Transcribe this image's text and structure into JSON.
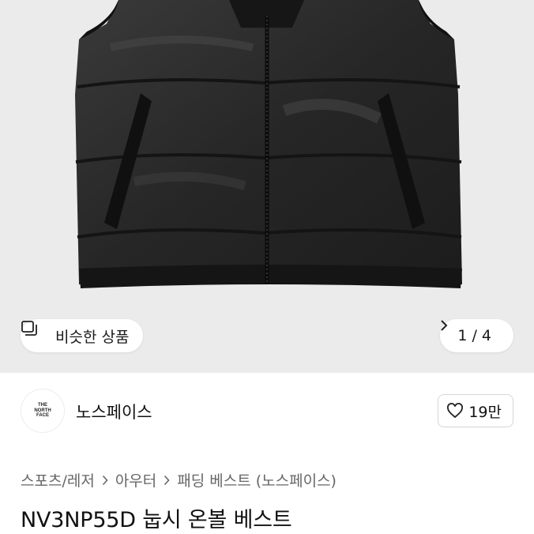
{
  "gallery": {
    "similar_label": "비슷한 상품",
    "pager_label": "1 / 4",
    "current_page": 1,
    "total_pages": 4
  },
  "seller": {
    "logo_line1": "THE",
    "logo_line2": "NORTH",
    "logo_line3": "FACE",
    "name": "노스페이스",
    "likes": "19만"
  },
  "breadcrumb": [
    "스포츠/레저",
    "아우터",
    "패딩 베스트 (노스페이스)"
  ],
  "product": {
    "title": "NV3NP55D 눕시 온볼 베스트"
  },
  "icons": {
    "similar": "similar-products-icon",
    "pager_next": "chevron-right-icon",
    "like": "heart-outline-icon",
    "breadcrumb_sep": "chevron-right-icon"
  }
}
